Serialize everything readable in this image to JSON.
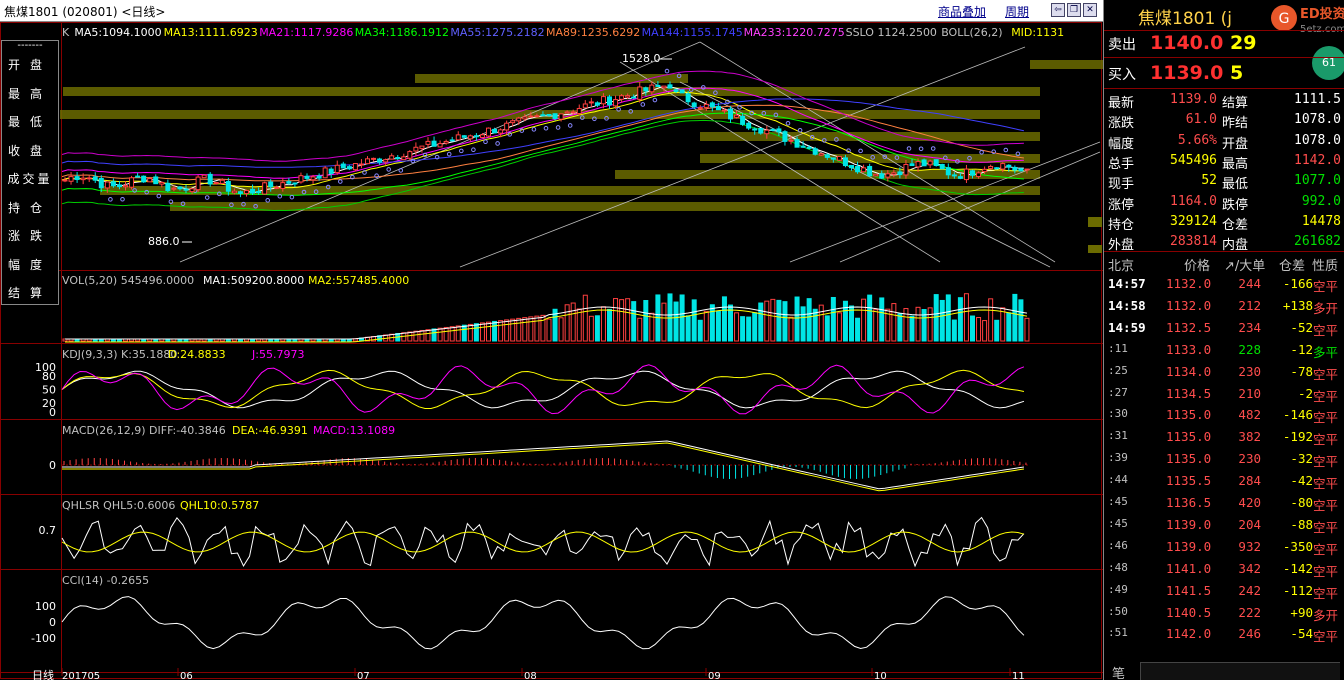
{
  "window": {
    "title": "焦煤1801 (020801) <日线>",
    "menu_overlay": "商品叠加",
    "menu_period": "周期"
  },
  "indicators": {
    "ma_line": [
      "K",
      "MA5:1094.1000",
      "MA13:1111.6923",
      "MA21:1117.9286",
      "MA34:1186.1912",
      "MA55:1275.2182",
      "MA89:1235.6292",
      "MA144:1155.1745",
      "MA233:1220.7275",
      "SSLO 1124.2500",
      "BOLL(26,2)",
      "MID:1131"
    ],
    "ma_colors": [
      "#c0c0c0",
      "#ffffff",
      "#ffff00",
      "#ff00ff",
      "#00ff00",
      "#6060ff",
      "#ff8040",
      "#4040ff",
      "#ff40ff",
      "#c0c0c0",
      "#c0c0c0",
      "#ffff00"
    ],
    "high_label": "1528.0",
    "low_label": "886.0",
    "vol": [
      "VOL(5,20) 545496.0000",
      "MA1:509200.8000",
      "MA2:557485.4000"
    ],
    "kdj": [
      "KDJ(9,3,3) K:35.1880",
      "D:24.8833",
      "J:55.7973"
    ],
    "macd": [
      "MACD(26,12,9) DIFF:-40.3846",
      "DEA:-46.9391",
      "MACD:13.1089"
    ],
    "qhlsr": [
      "QHLSR QHL5:0.6006",
      "QHL10:0.5787"
    ],
    "cci": [
      "CCI(14) -0.2655"
    ]
  },
  "axis": {
    "kdj_ticks": [
      "100",
      "80",
      "50",
      "20",
      "0"
    ],
    "macd_tick": "0",
    "qhl_tick": "0.7",
    "cci_ticks": [
      "100",
      "0",
      "-100"
    ],
    "x_ticks": [
      "201705",
      "06",
      "07",
      "08",
      "09",
      "10",
      "11"
    ],
    "bottom_left": "日线"
  },
  "side_menu": {
    "head": "-------",
    "items": [
      "开盘",
      "最高",
      "最低",
      "收盘",
      "成交量",
      "持仓",
      "涨跌",
      "幅度",
      "结算"
    ]
  },
  "quote": {
    "title": "焦煤1801 (j",
    "logo_text": "5etz.com",
    "logo_mark": "ED投资",
    "sell_label": "卖出",
    "sell_price": "1140.0",
    "sell_vol": "29",
    "buy_label": "买入",
    "buy_price": "1139.0",
    "buy_vol": "5",
    "stats": [
      {
        "l1": "最新",
        "v1": "1139.0",
        "c1": "red",
        "l2": "结算",
        "v2": "1111.5",
        "c2": "white"
      },
      {
        "l1": "涨跌",
        "v1": "61.0",
        "c1": "red",
        "l2": "昨结",
        "v2": "1078.0",
        "c2": "white"
      },
      {
        "l1": "幅度",
        "v1": "5.66%",
        "c1": "red",
        "l2": "开盘",
        "v2": "1078.0",
        "c2": "white"
      },
      {
        "l1": "总手",
        "v1": "545496",
        "c1": "yellow",
        "l2": "最高",
        "v2": "1142.0",
        "c2": "red"
      },
      {
        "l1": "现手",
        "v1": "52",
        "c1": "yellow",
        "l2": "最低",
        "v2": "1077.0",
        "c2": "green"
      },
      {
        "l1": "涨停",
        "v1": "1164.0",
        "c1": "red",
        "l2": "跌停",
        "v2": "992.0",
        "c2": "green"
      },
      {
        "l1": "持仓",
        "v1": "329124",
        "c1": "yellow",
        "l2": "仓差",
        "v2": "14478",
        "c2": "yellow"
      },
      {
        "l1": "外盘",
        "v1": "283814",
        "c1": "red",
        "l2": "内盘",
        "v2": "261682",
        "c2": "green"
      }
    ],
    "tick_header": [
      "北京",
      "价格",
      "↗/大单",
      "仓差",
      "性质"
    ],
    "ticks": [
      {
        "t": "14:57",
        "p": "1132.0",
        "v": "244",
        "d": "-166",
        "n": "空平",
        "nc": "red",
        "dc": "yellow"
      },
      {
        "t": "14:58",
        "p": "1132.0",
        "v": "212",
        "d": "+138",
        "n": "多开",
        "nc": "red",
        "dc": "yellow"
      },
      {
        "t": "14:59",
        "p": "1132.5",
        "v": "234",
        "d": "-52",
        "n": "空平",
        "nc": "red",
        "dc": "yellow"
      },
      {
        "t": ":11",
        "p": "1133.0",
        "v": "228",
        "d": "-12",
        "n": "多平",
        "nc": "green",
        "dc": "yellow",
        "vc": "green"
      },
      {
        "t": ":25",
        "p": "1134.0",
        "v": "230",
        "d": "-78",
        "n": "空平",
        "nc": "red",
        "dc": "yellow"
      },
      {
        "t": ":27",
        "p": "1134.5",
        "v": "210",
        "d": "-2",
        "n": "空平",
        "nc": "red",
        "dc": "yellow"
      },
      {
        "t": ":30",
        "p": "1135.0",
        "v": "482",
        "d": "-146",
        "n": "空平",
        "nc": "red",
        "dc": "yellow"
      },
      {
        "t": ":31",
        "p": "1135.0",
        "v": "382",
        "d": "-192",
        "n": "空平",
        "nc": "red",
        "dc": "yellow"
      },
      {
        "t": ":39",
        "p": "1135.0",
        "v": "230",
        "d": "-32",
        "n": "空平",
        "nc": "red",
        "dc": "yellow"
      },
      {
        "t": ":44",
        "p": "1135.5",
        "v": "284",
        "d": "-42",
        "n": "空平",
        "nc": "red",
        "dc": "yellow"
      },
      {
        "t": ":45",
        "p": "1136.5",
        "v": "420",
        "d": "-80",
        "n": "空平",
        "nc": "red",
        "dc": "yellow"
      },
      {
        "t": ":45",
        "p": "1139.0",
        "v": "204",
        "d": "-88",
        "n": "空平",
        "nc": "red",
        "dc": "yellow"
      },
      {
        "t": ":46",
        "p": "1139.0",
        "v": "932",
        "d": "-350",
        "n": "空平",
        "nc": "red",
        "dc": "yellow"
      },
      {
        "t": ":48",
        "p": "1141.0",
        "v": "342",
        "d": "-142",
        "n": "空平",
        "nc": "red",
        "dc": "yellow"
      },
      {
        "t": ":49",
        "p": "1141.5",
        "v": "242",
        "d": "-112",
        "n": "空平",
        "nc": "red",
        "dc": "yellow"
      },
      {
        "t": ":50",
        "p": "1140.5",
        "v": "222",
        "d": "+90",
        "n": "多开",
        "nc": "red",
        "dc": "yellow"
      },
      {
        "t": ":51",
        "p": "1142.0",
        "v": "246",
        "d": "-54",
        "n": "空平",
        "nc": "red",
        "dc": "yellow"
      }
    ],
    "bottom_label": "笔"
  }
}
